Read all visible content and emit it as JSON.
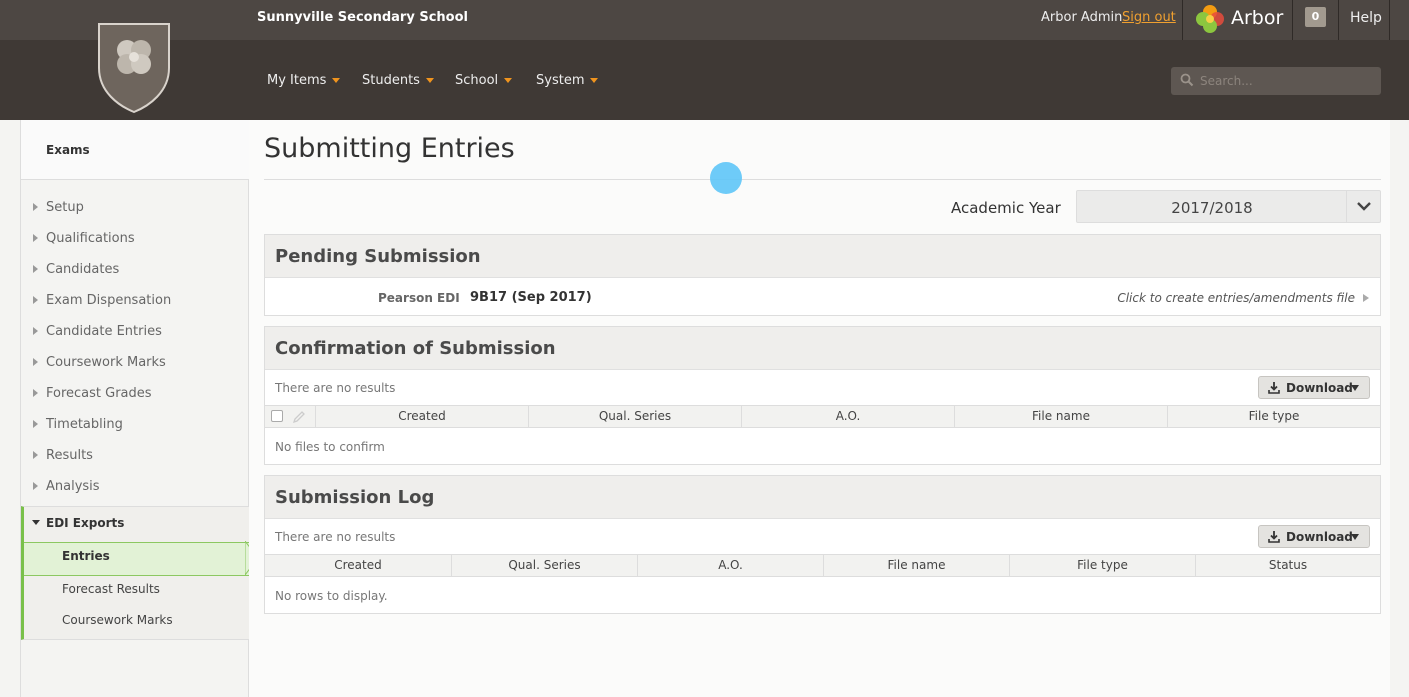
{
  "header": {
    "school_name": "Sunnyville Secondary School",
    "user_name": "Arbor Admin",
    "sign_out": "Sign out",
    "brand": "Arbor",
    "notifications": "0",
    "help": "Help",
    "accent_color": "#f0941e"
  },
  "nav": {
    "items": [
      {
        "label": "My Items"
      },
      {
        "label": "Students"
      },
      {
        "label": "School"
      },
      {
        "label": "System"
      }
    ],
    "search_placeholder": "Search..."
  },
  "sidebar": {
    "title": "Exams",
    "items": [
      {
        "label": "Setup"
      },
      {
        "label": "Qualifications"
      },
      {
        "label": "Candidates"
      },
      {
        "label": "Exam Dispensation"
      },
      {
        "label": "Candidate Entries"
      },
      {
        "label": "Coursework Marks"
      },
      {
        "label": "Forecast Grades"
      },
      {
        "label": "Timetabling"
      },
      {
        "label": "Results"
      },
      {
        "label": "Analysis"
      }
    ],
    "group": {
      "label": "EDI Exports",
      "items": [
        {
          "label": "Entries",
          "active": true
        },
        {
          "label": "Forecast Results"
        },
        {
          "label": "Coursework Marks"
        }
      ]
    }
  },
  "main": {
    "title": "Submitting Entries",
    "academic_year_label": "Academic Year",
    "academic_year_value": "2017/2018",
    "pending": {
      "title": "Pending Submission",
      "row_label": "Pearson EDI",
      "row_value": "9B17 (Sep 2017)",
      "action": "Click to create entries/amendments file"
    },
    "confirmation": {
      "title": "Confirmation of Submission",
      "no_results": "There are no results",
      "download": "Download",
      "columns": [
        "Created",
        "Qual. Series",
        "A.O.",
        "File name",
        "File type"
      ],
      "empty": "No files to confirm"
    },
    "log": {
      "title": "Submission Log",
      "no_results": "There are no results",
      "download": "Download",
      "columns": [
        "Created",
        "Qual. Series",
        "A.O.",
        "File name",
        "File type",
        "Status"
      ],
      "empty": "No rows to display."
    }
  }
}
